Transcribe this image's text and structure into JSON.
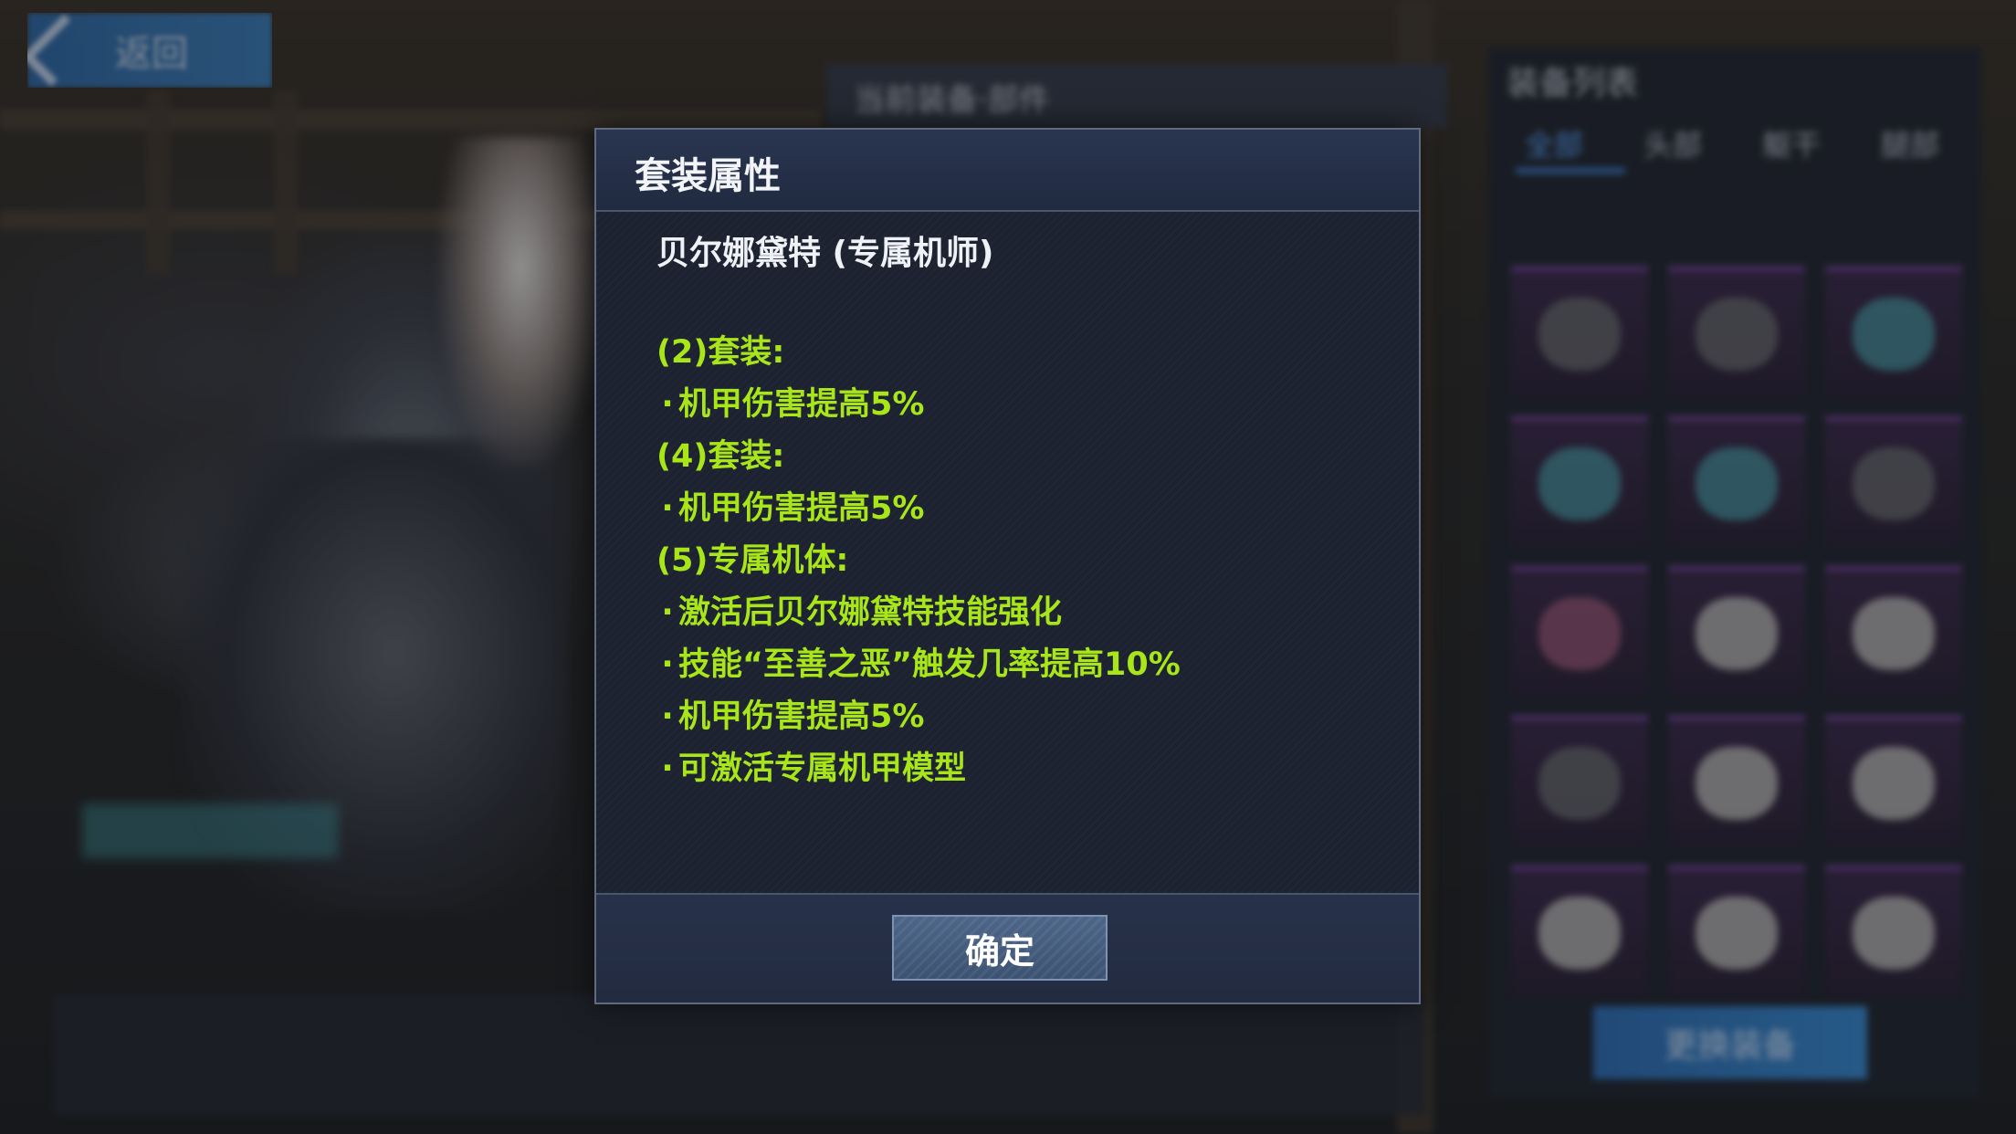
{
  "background": {
    "back_label": "返回",
    "mid_bar_title": "当前装备·部件",
    "right_panel": {
      "title": "装备列表",
      "tabs": [
        "全部",
        "头部",
        "躯干",
        "腿部"
      ],
      "equip_button": "更换装备"
    }
  },
  "modal": {
    "title": "套装属性",
    "set_name": "贝尔娜黛特 (专属机师)",
    "effects": [
      {
        "kind": "header",
        "text": "(2)套装:"
      },
      {
        "kind": "item",
        "text": "机甲伤害提高5%"
      },
      {
        "kind": "header",
        "text": "(4)套装:"
      },
      {
        "kind": "item",
        "text": "机甲伤害提高5%"
      },
      {
        "kind": "header",
        "text": "(5)专属机体:"
      },
      {
        "kind": "item",
        "text": "激活后贝尔娜黛特技能强化"
      },
      {
        "kind": "item",
        "text": "技能“至善之恶”触发几率提高10%"
      },
      {
        "kind": "item",
        "text": "机甲伤害提高5%"
      },
      {
        "kind": "item",
        "text": "可激活专属机甲模型"
      }
    ],
    "confirm_label": "确定"
  },
  "colors": {
    "effect_text": "#a8e619",
    "modal_bg": "#1c2230",
    "header_bg": "#2a3550",
    "button_bg": "#4d6688"
  }
}
